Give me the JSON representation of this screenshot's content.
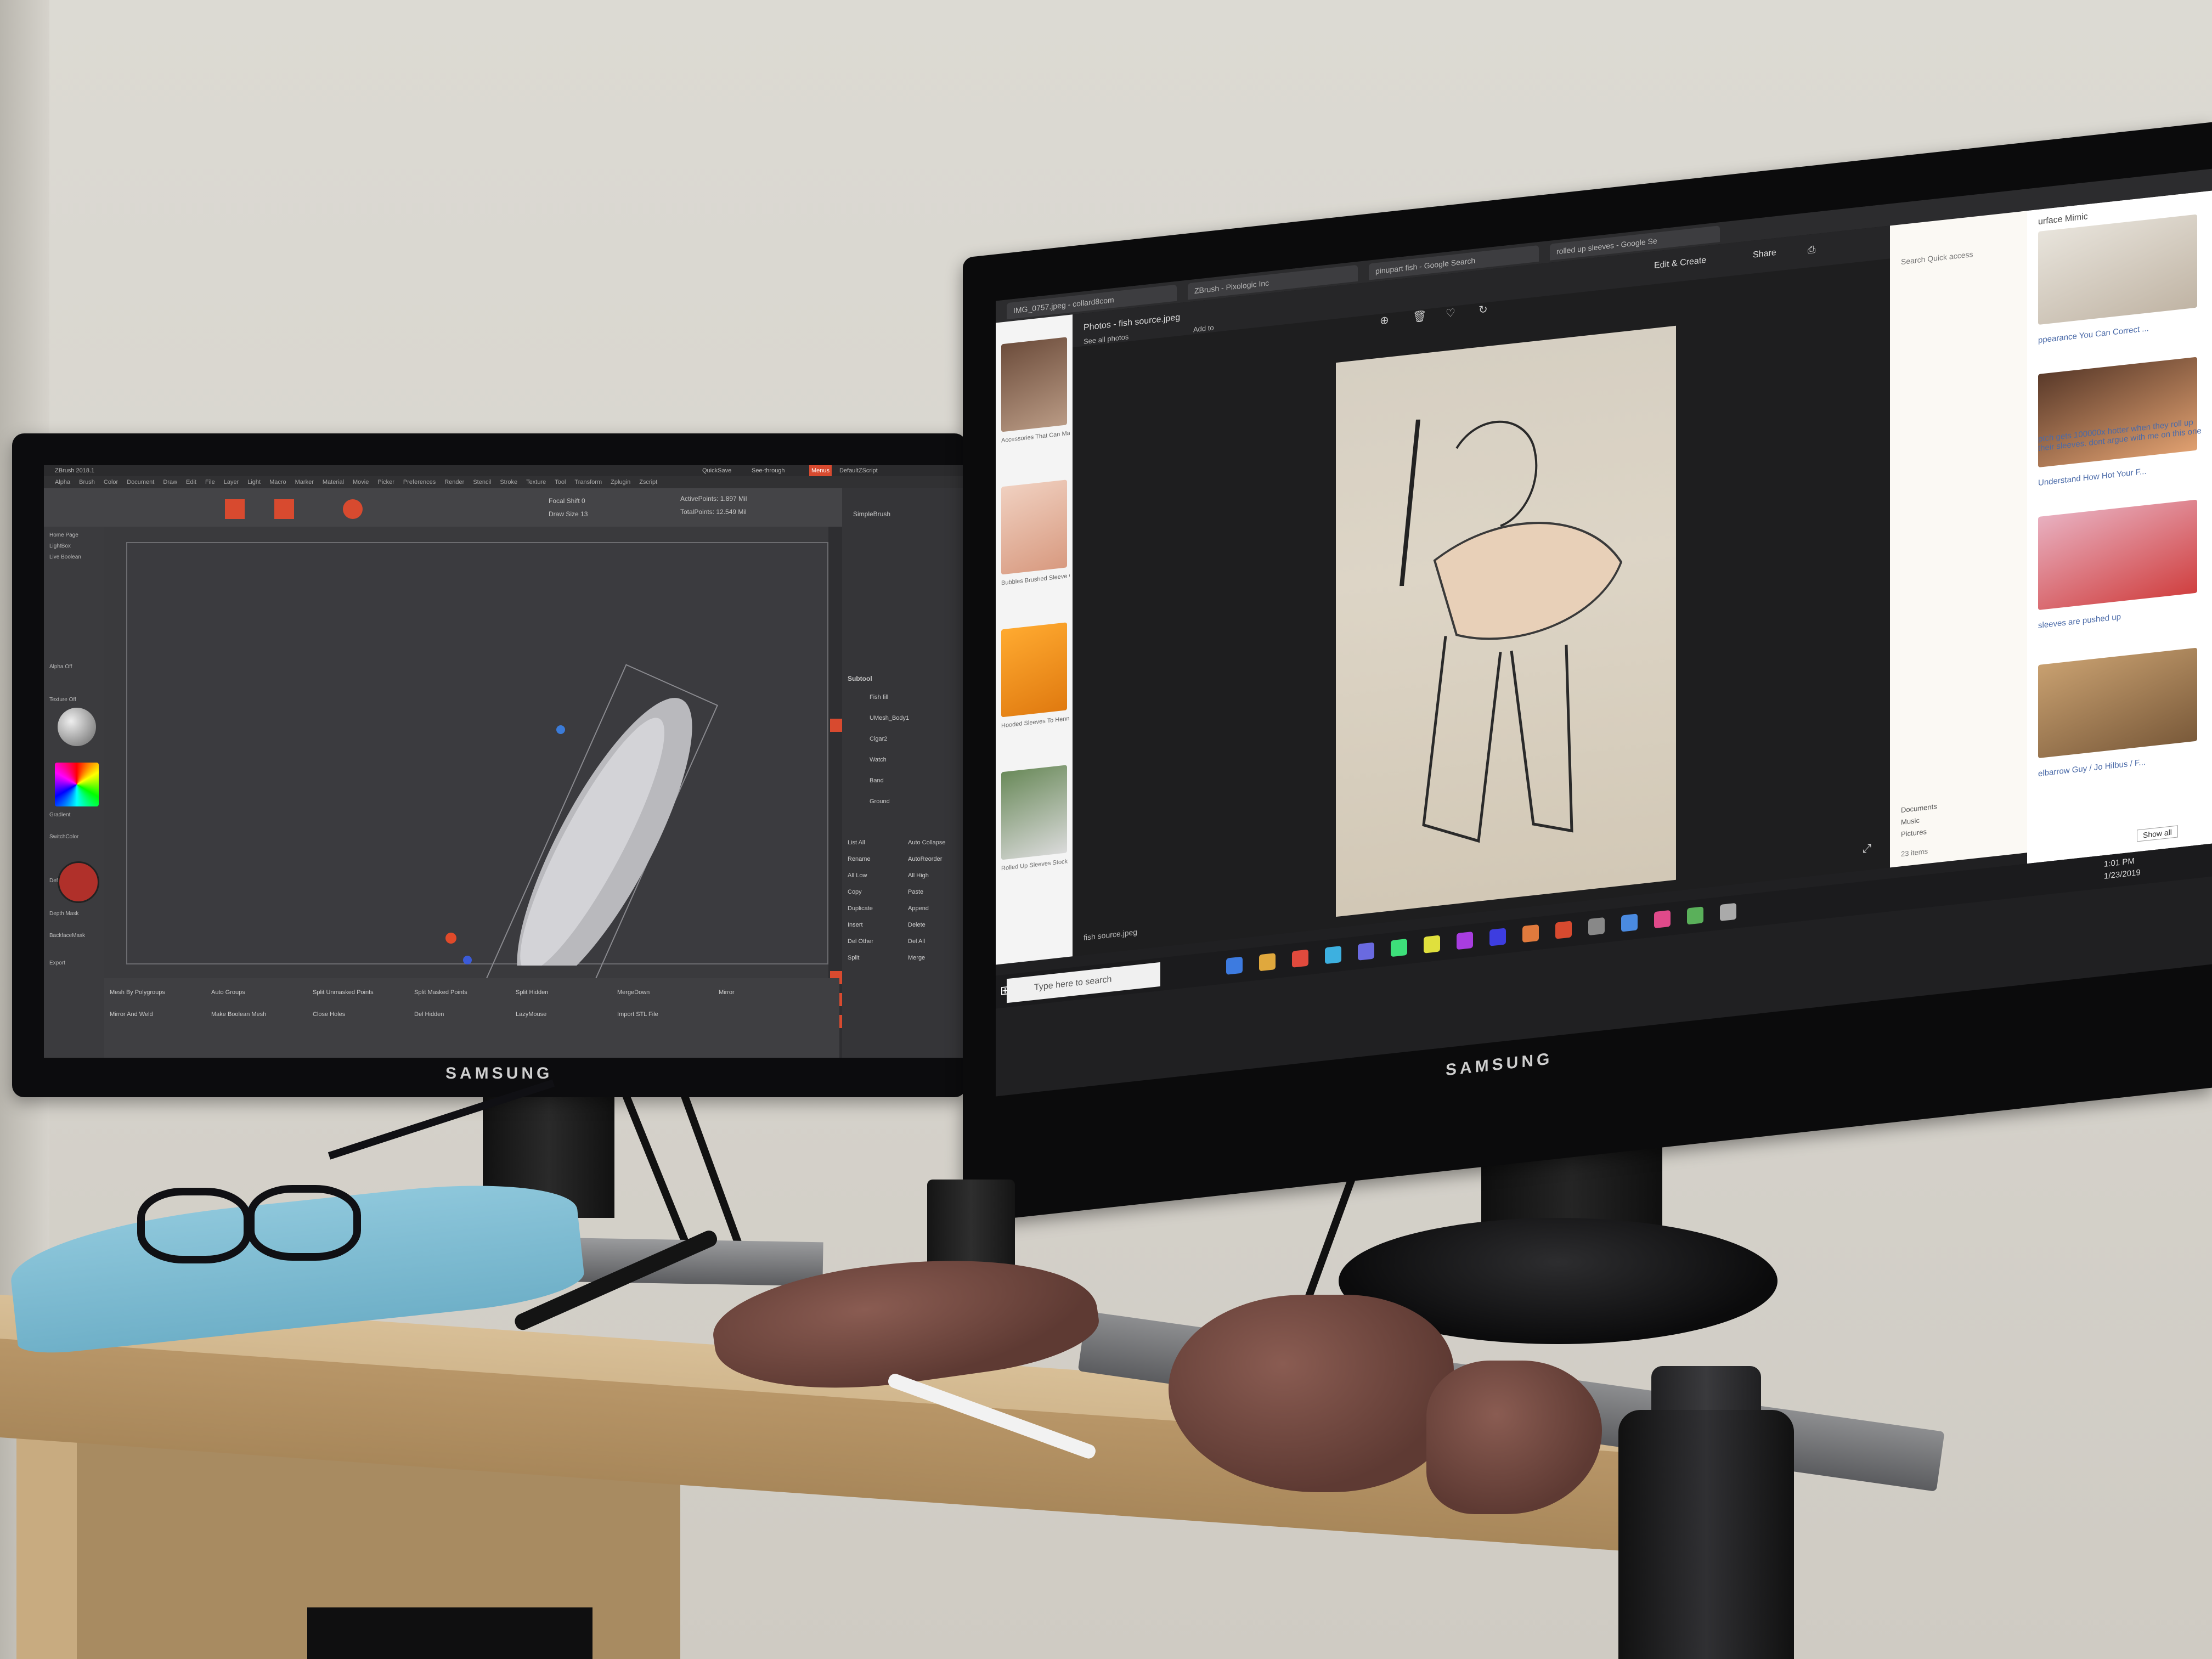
{
  "scene": {
    "description_label": "",
    "monitor_brand_left": "SAMSUNG",
    "monitor_brand_right": "SAMSUNG"
  },
  "zbrush": {
    "title": "ZBrush 2018.1",
    "menu_items": [
      "Alpha",
      "Brush",
      "Color",
      "Document",
      "Draw",
      "Edit",
      "File",
      "Layer",
      "Light",
      "Macro",
      "Marker",
      "Material",
      "Movie",
      "Picker",
      "Preferences",
      "Render",
      "Stencil",
      "Stroke",
      "Texture",
      "Tool",
      "Transform",
      "Zplugin",
      "Zscript"
    ],
    "quicksave": "QuickSave",
    "see_through": "See-through",
    "menus": "Menus",
    "default_zscript": "DefaultZScript",
    "active_points": "ActivePoints: 1.897 Mil",
    "total_points": "TotalPoints: 12.549 Mil",
    "focal_shift": "Focal Shift 0",
    "draw_size": "Draw Size 13",
    "brush_name": "SimpleBrush",
    "subtool_header": "Subtool",
    "subtools": [
      "Fish fill",
      "UMesh_Body1",
      "Cigar2",
      "Watch",
      "Band",
      "Ground"
    ],
    "bottom_buttons": [
      "Mesh By Polygroups",
      "Auto Groups",
      "Split Unmasked Points",
      "Split Masked Points",
      "Split Hidden",
      "MergeDown",
      "Mirror",
      "Mirror And Weld",
      "Make Boolean Mesh",
      "Close Holes",
      "Del Hidden",
      "LazyMouse",
      "Import STL File"
    ],
    "right_list": [
      "List All",
      "Auto Collapse",
      "Rename",
      "AutoReorder",
      "All Low",
      "All High",
      "Copy",
      "Paste",
      "Duplicate",
      "Append",
      "Insert",
      "Delete",
      "Del Other",
      "Del All",
      "Split",
      "Merge"
    ],
    "left_labels": [
      "Home Page",
      "LightBox",
      "Live Boolean",
      "Alpha Off",
      "Texture Off",
      "Gradient",
      "SwitchColor",
      "Default",
      "Depth Mask",
      "BackfaceMask",
      "Export"
    ]
  },
  "browser": {
    "tabs": [
      "IMG_0757.jpeg - collard8com",
      "ZBrush - Pixologic Inc",
      "pinupart fish - Google Search",
      "rolled up sleeves - Google Se"
    ],
    "photos_title": "Photos - fish source.jpeg",
    "see_all_photos": "See all photos",
    "add_to": "Add to",
    "edit_create": "Edit & Create",
    "share": "Share",
    "file_label": "fish source.jpeg",
    "search_quick_access": "Search Quick access",
    "sidebar_items": [
      "Documents",
      "Music",
      "Pictures"
    ],
    "item_count": "23 items",
    "results_header": "urface Mimic",
    "results": [
      "ppearance You Can Correct ...",
      "ptch gets 100000x hotter when they roll up their sleeves. dont argue with me on this one",
      "Understand How Hot Your F...",
      "sleeves are pushed up",
      "elbarrow Guy / Jo Hilbus / F..."
    ],
    "left_thumbs_captions": [
      "Accessories That Can Make",
      "Bubbles Brushed Sleeve Ca",
      "Hooded Sleeves To Henna",
      "Rolled Up Sleeves Stock Photo"
    ],
    "show_all": "Show all",
    "search_placeholder": "Type here to search",
    "clock_time": "1:01 PM",
    "clock_date": "1/23/2019"
  },
  "colors": {
    "zbrush_accent": "#d84a2f",
    "clay": "#6e463d",
    "towel": "#7fbcd2",
    "wood": "#c7ab80"
  }
}
